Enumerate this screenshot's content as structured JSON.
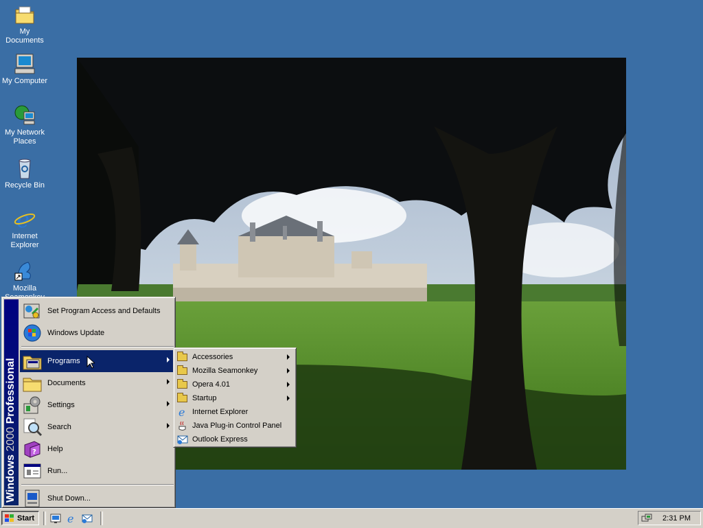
{
  "desktop": {
    "icons": [
      {
        "label": "My Documents"
      },
      {
        "label": "My Computer"
      },
      {
        "label": "My Network Places"
      },
      {
        "label": "Recycle Bin"
      },
      {
        "label": "Internet Explorer"
      },
      {
        "label": "Mozilla Seamonkey"
      }
    ]
  },
  "start_menu": {
    "banner_brand": "Windows",
    "banner_version": "2000",
    "banner_edition": "Professional",
    "items": [
      {
        "label": "Set Program Access and Defaults",
        "icon": "program-access-icon"
      },
      {
        "label": "Windows Update",
        "icon": "windows-update-icon"
      },
      {
        "label": "Programs",
        "icon": "programs-folder-icon",
        "submenu": true,
        "highlighted": true
      },
      {
        "label": "Documents",
        "icon": "documents-folder-icon",
        "submenu": true
      },
      {
        "label": "Settings",
        "icon": "settings-icon",
        "submenu": true
      },
      {
        "label": "Search",
        "icon": "search-icon",
        "submenu": true
      },
      {
        "label": "Help",
        "icon": "help-book-icon"
      },
      {
        "label": "Run...",
        "icon": "run-icon"
      },
      {
        "label": "Shut Down...",
        "icon": "shut-down-icon"
      }
    ]
  },
  "programs_submenu": {
    "items": [
      {
        "label": "Accessories",
        "icon": "folder-icon",
        "submenu": true
      },
      {
        "label": "Mozilla Seamonkey",
        "icon": "folder-icon",
        "submenu": true
      },
      {
        "label": "Opera 4.01",
        "icon": "folder-icon",
        "submenu": true
      },
      {
        "label": "Startup",
        "icon": "folder-icon",
        "submenu": true
      },
      {
        "label": "Internet Explorer",
        "icon": "internet-explorer-icon"
      },
      {
        "label": "Java Plug-in Control Panel",
        "icon": "java-icon"
      },
      {
        "label": "Outlook Express",
        "icon": "outlook-express-icon"
      }
    ]
  },
  "taskbar": {
    "start_label": "Start",
    "quick_launch": [
      "show-desktop-icon",
      "internet-explorer-icon",
      "outlook-express-icon"
    ],
    "clock": "2:31 PM"
  },
  "colors": {
    "desktop": "#3a6ea5",
    "menu_face": "#d4d0c8",
    "highlight": "#0a246a"
  }
}
